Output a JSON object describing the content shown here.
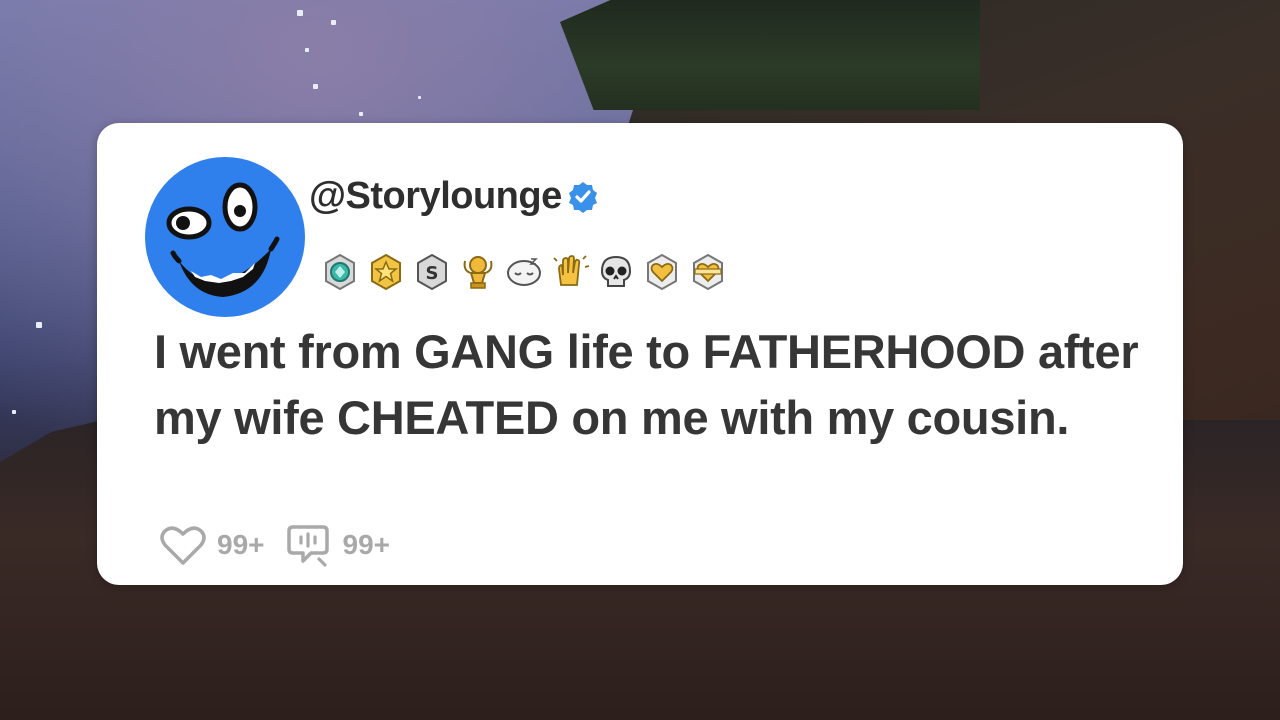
{
  "post": {
    "handle": "@Storylounge",
    "verified": true,
    "text": "I went from GANG life to FATHERHOOD after my wife CHEATED on me with my cousin.",
    "like_count": "99+",
    "comment_count": "99+"
  },
  "badges": [
    "teal-gem-badge-icon",
    "gold-star-badge-icon",
    "silver-s-badge-icon",
    "gold-trophy-badge-icon",
    "sleeping-face-badge-icon",
    "clapping-hands-badge-icon",
    "skull-badge-icon",
    "gold-heart-badge-icon",
    "gold-heart-ribbon-badge-icon"
  ],
  "colors": {
    "avatar": "#2f80ec",
    "verified": "#3a91ea",
    "text": "#363636",
    "muted": "#a9a9a9",
    "card": "#ffffff"
  }
}
